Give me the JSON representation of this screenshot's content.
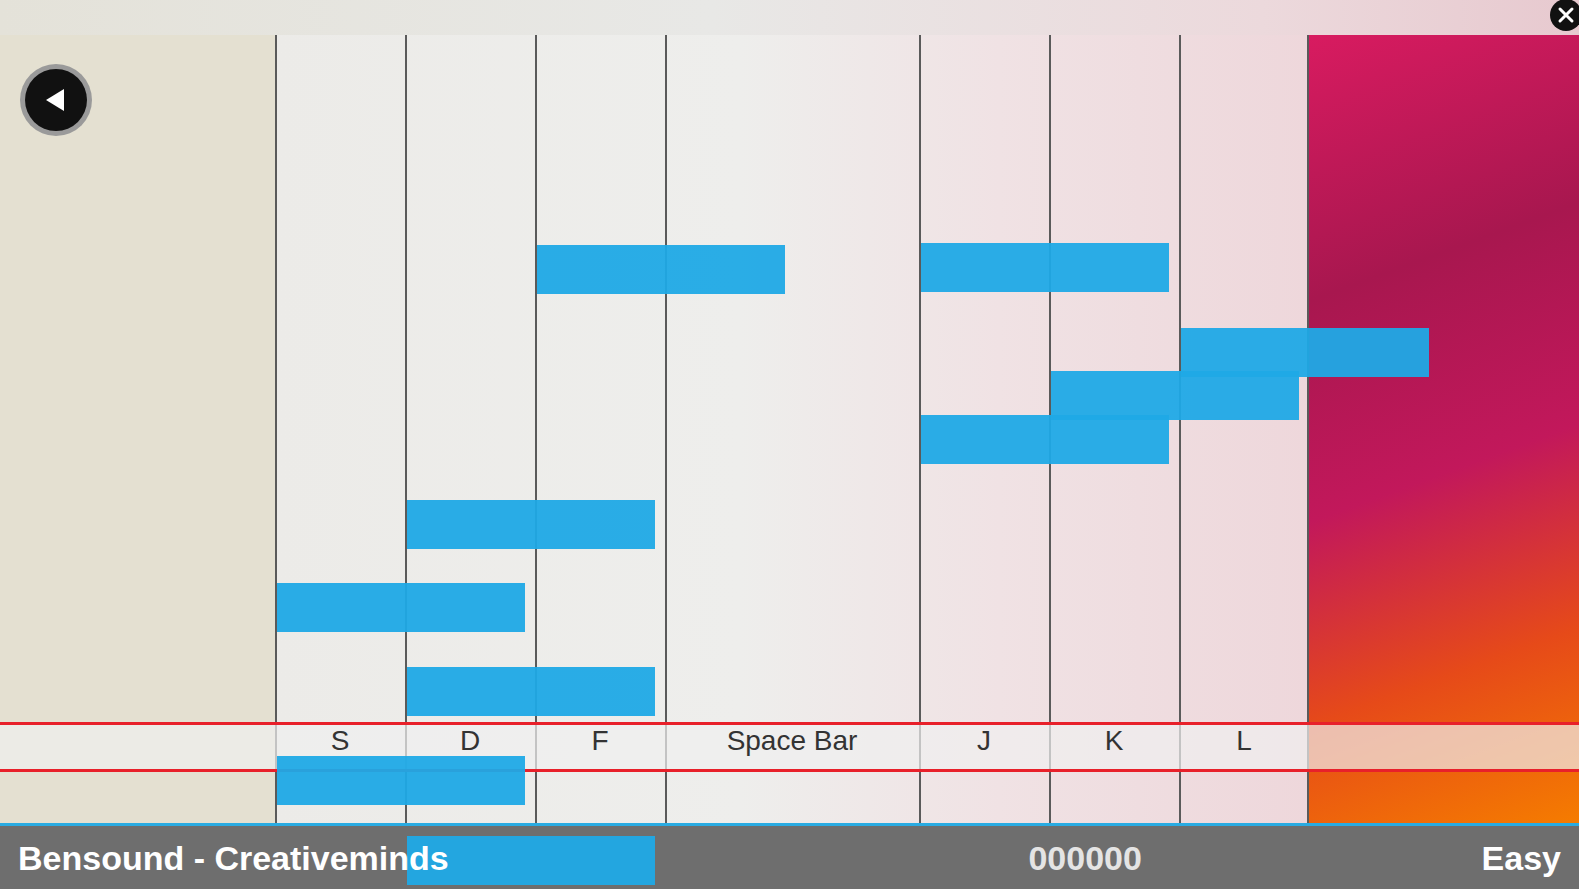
{
  "song": {
    "title": "Bensound - Creativeminds",
    "score": "000000",
    "difficulty": "Easy"
  },
  "lanes": [
    {
      "key": "S",
      "kind": "key"
    },
    {
      "key": "D",
      "kind": "key"
    },
    {
      "key": "F",
      "kind": "key"
    },
    {
      "key": "Space Bar",
      "kind": "wide"
    },
    {
      "key": "J",
      "kind": "key"
    },
    {
      "key": "K",
      "kind": "key"
    },
    {
      "key": "L",
      "kind": "key"
    }
  ],
  "notes": [
    {
      "lane": "F",
      "offset": 210
    },
    {
      "lane": "J",
      "offset": 208
    },
    {
      "lane": "L",
      "offset": 293
    },
    {
      "lane": "K",
      "offset": 336
    },
    {
      "lane": "J",
      "offset": 380
    },
    {
      "lane": "D",
      "offset": 465
    },
    {
      "lane": "S",
      "offset": 548
    },
    {
      "lane": "D",
      "offset": 632
    },
    {
      "lane": "S",
      "offset": 721
    },
    {
      "lane": "D",
      "offset": 801
    }
  ]
}
